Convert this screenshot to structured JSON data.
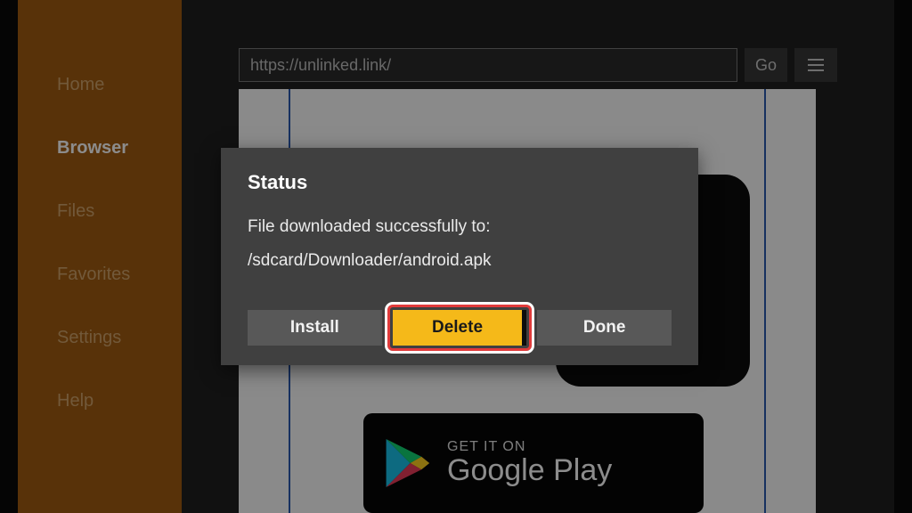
{
  "sidebar": {
    "items": [
      {
        "label": "Home"
      },
      {
        "label": "Browser"
      },
      {
        "label": "Files"
      },
      {
        "label": "Favorites"
      },
      {
        "label": "Settings"
      },
      {
        "label": "Help"
      }
    ],
    "active_index": 1
  },
  "address": {
    "url": "https://unlinked.link/",
    "go_label": "Go"
  },
  "badge": {
    "small": "GET IT ON",
    "big": "Google Play"
  },
  "dialog": {
    "title": "Status",
    "message": "File downloaded successfully to:",
    "path": "/sdcard/Downloader/android.apk",
    "buttons": {
      "install": "Install",
      "delete": "Delete",
      "done": "Done"
    },
    "focused": "delete"
  }
}
